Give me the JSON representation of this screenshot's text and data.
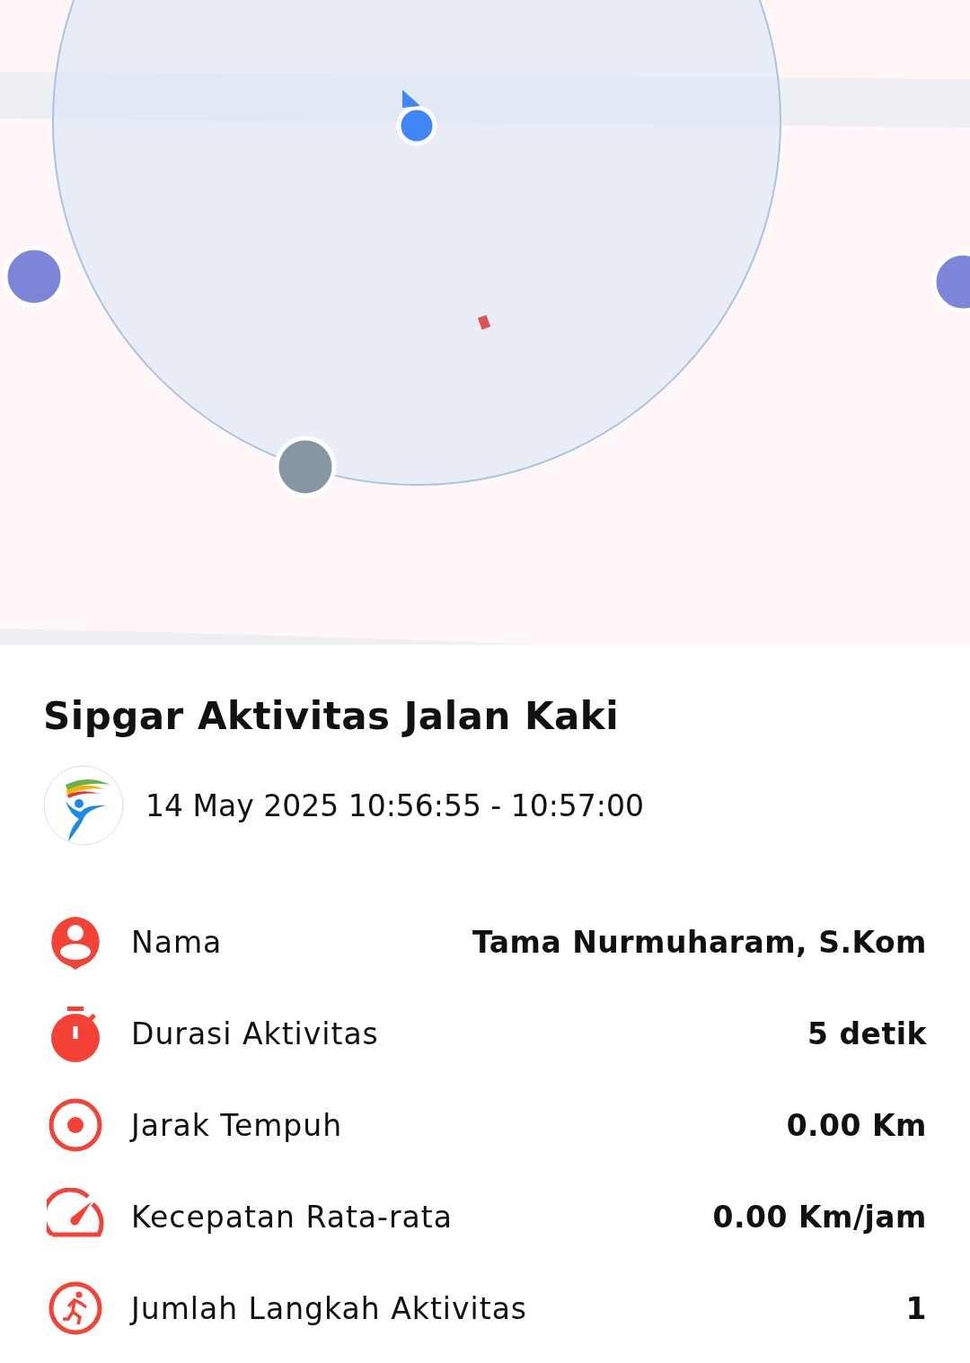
{
  "title": "Sipgar Aktivitas Jalan Kaki",
  "session": {
    "datetime": "14 May 2025 10:56:55 - 10:57:00"
  },
  "stats": [
    {
      "kind": "person",
      "label": "Nama",
      "value": "Tama Nurmuharam, S.Kom"
    },
    {
      "kind": "timer",
      "label": "Durasi Aktivitas",
      "value": "5 detik"
    },
    {
      "kind": "target",
      "label": "Jarak Tempuh",
      "value": "0.00 Km"
    },
    {
      "kind": "speed",
      "label": "Kecepatan Rata-rata",
      "value": "0.00 Km/jam"
    },
    {
      "kind": "steps",
      "label": "Jumlah Langkah Aktivitas",
      "value": "1"
    }
  ]
}
